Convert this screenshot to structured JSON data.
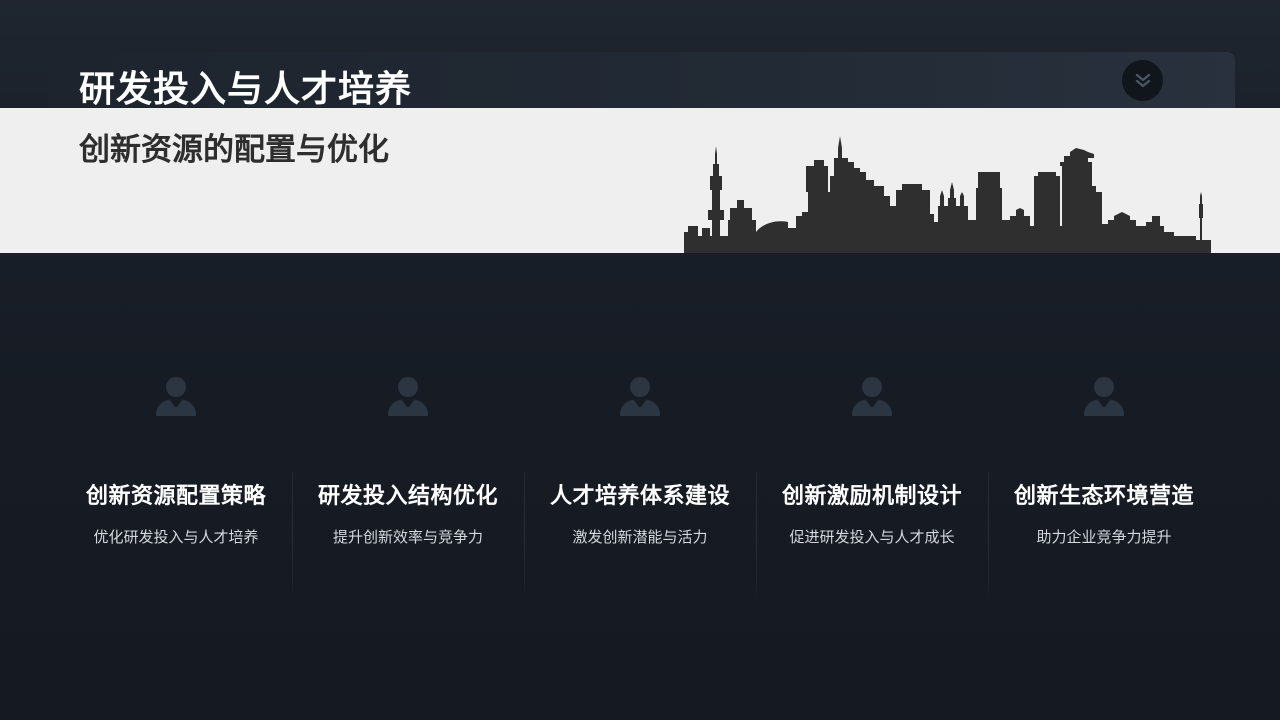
{
  "slide": {
    "title": "研发投入与人才培养",
    "subtitle": "创新资源的配置与优化",
    "badge_icon": "double-chevron-down-icon",
    "skyline_icon": "city-skyline-silhouette"
  },
  "colors": {
    "dark_bg": "#161b24",
    "light_band": "#efefef",
    "skyline": "#2f2f2f",
    "icon": "#2c3643",
    "title_text": "#ffffff"
  },
  "cards": [
    {
      "icon": "user-icon",
      "title": "创新资源配置策略",
      "desc": "优化研发投入与人才培养"
    },
    {
      "icon": "user-icon",
      "title": "研发投入结构优化",
      "desc": "提升创新效率与竞争力"
    },
    {
      "icon": "user-icon",
      "title": "人才培养体系建设",
      "desc": "激发创新潜能与活力"
    },
    {
      "icon": "user-icon",
      "title": "创新激励机制设计",
      "desc": "促进研发投入与人才成长"
    },
    {
      "icon": "user-icon",
      "title": "创新生态环境营造",
      "desc": "助力企业竞争力提升"
    }
  ]
}
